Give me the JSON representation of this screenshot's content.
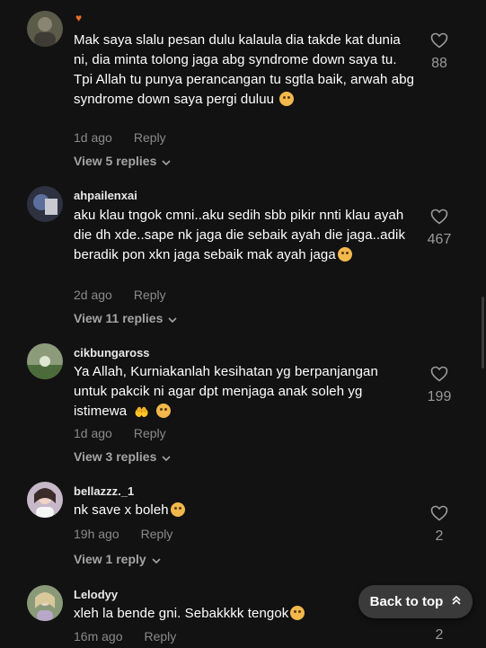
{
  "comments": [
    {
      "username": "",
      "badge": "♥",
      "text": "Mak saya slalu pesan dulu kalaula dia takde kat dunia ni, dia minta tolong jaga abg syndrome down saya tu. Tpi Allah tu punya perancangan tu sgtla baik, arwah abg syndrome down saya pergi duluu",
      "emoji": "pensive-face",
      "time": "1d ago",
      "reply_label": "Reply",
      "view_replies": "View 5 replies",
      "likes": "88"
    },
    {
      "username": "ahpailenxai",
      "text": "aku klau tngok cmni..aku sedih sbb pikir nnti klau ayah die dh xde..sape nk jaga die sebaik ayah die jaga..adik beradik pon xkn jaga sebaik mak ayah jaga",
      "emoji": "pleading-face",
      "time": "2d ago",
      "reply_label": "Reply",
      "view_replies": "View 11 replies",
      "likes": "467"
    },
    {
      "username": "cikbungaross",
      "text": "Ya Allah, Kurniakanlah kesihatan yg berpanjangan untuk pakcik ni agar dpt menjaga anak soleh yg istimewa",
      "emoji": "praying-hands pleading-face",
      "time": "1d ago",
      "reply_label": "Reply",
      "view_replies": "View 3 replies",
      "likes": "199"
    },
    {
      "username": "bellazzz._1",
      "text": "nk save x boleh",
      "emoji": "crying-face",
      "time": "19h ago",
      "reply_label": "Reply",
      "view_replies": "View 1 reply",
      "likes": "2"
    },
    {
      "username": "Lelodyy",
      "text": "xleh la bende gni. Sebakkkk tengok",
      "emoji": "pleading-face",
      "time": "16m ago",
      "reply_label": "Reply",
      "likes": "2"
    }
  ],
  "back_to_top": {
    "label": "Back to top"
  },
  "colors": {
    "background": "#121212",
    "text": "#ffffff",
    "muted": "#8a8a8a",
    "badge": "#e8702a"
  }
}
